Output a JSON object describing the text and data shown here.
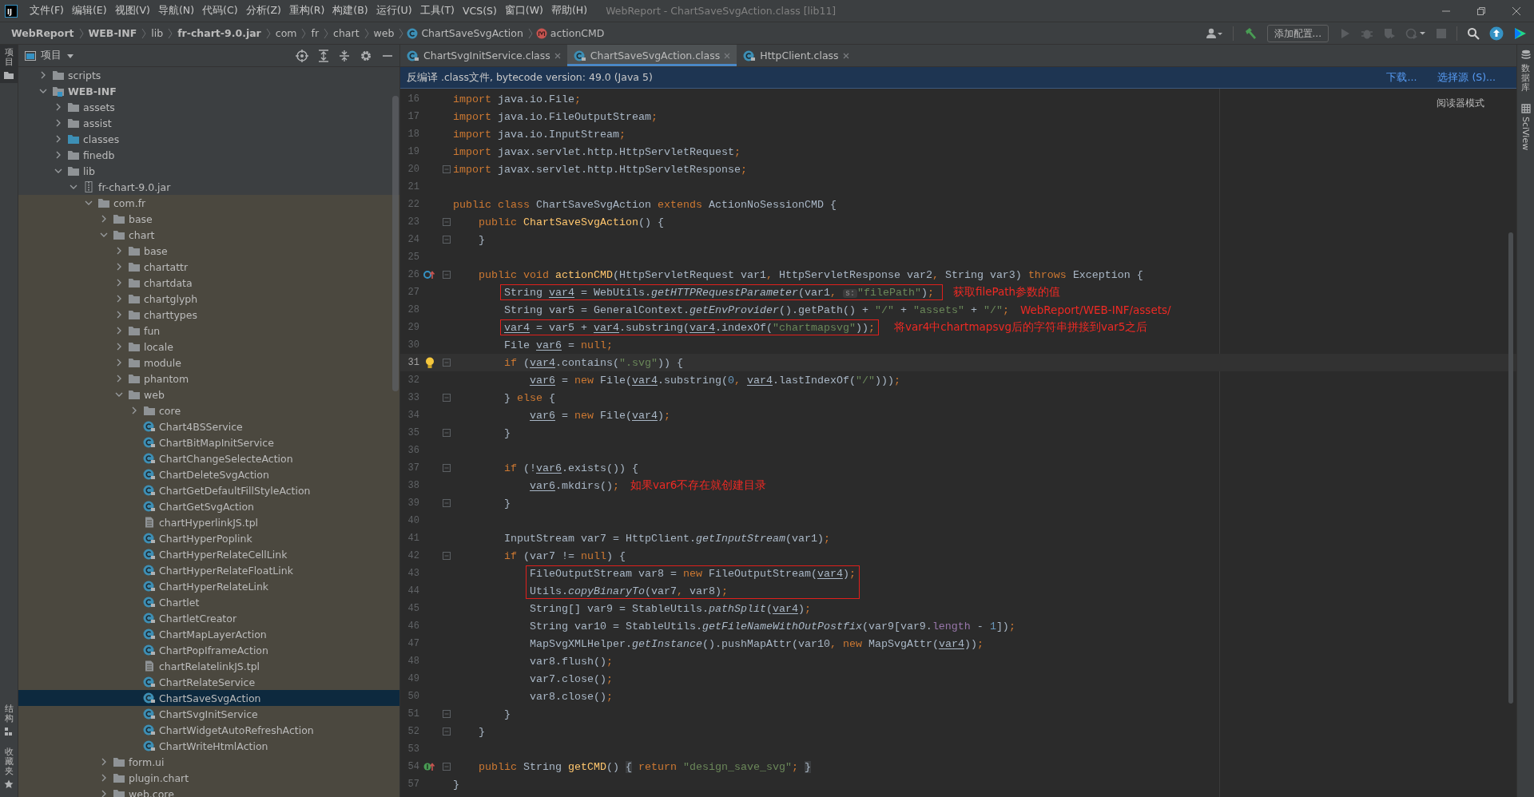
{
  "window": {
    "logo_text": "IJ",
    "title": "WebReport - ChartSaveSvgAction.class [lib11]"
  },
  "menu": [
    "文件(F)",
    "编辑(E)",
    "视图(V)",
    "导航(N)",
    "代码(C)",
    "分析(Z)",
    "重构(R)",
    "构建(B)",
    "运行(U)",
    "工具(T)",
    "VCS(S)",
    "窗口(W)",
    "帮助(H)"
  ],
  "breadcrumb": [
    {
      "label": "WebReport",
      "kind": "bold"
    },
    {
      "label": "WEB-INF",
      "kind": "bold"
    },
    {
      "label": "lib",
      "kind": "plain"
    },
    {
      "label": "fr-chart-9.0.jar",
      "kind": "bold"
    },
    {
      "label": "com",
      "kind": "plain"
    },
    {
      "label": "fr",
      "kind": "plain"
    },
    {
      "label": "chart",
      "kind": "plain"
    },
    {
      "label": "web",
      "kind": "plain"
    },
    {
      "label": "ChartSaveSvgAction",
      "kind": "class"
    },
    {
      "label": "actionCMD",
      "kind": "method"
    }
  ],
  "toolbar": {
    "config_button": "添加配置..."
  },
  "left_strip": {
    "top": [
      "项目"
    ],
    "bottom": [
      "结构",
      "收藏夹"
    ]
  },
  "right_strip": [
    "数据库",
    "SciView"
  ],
  "project_panel": {
    "title": "项目"
  },
  "tree": {
    "items": [
      {
        "label": "scripts",
        "kind": "folder",
        "selected": false,
        "expanded": false
      },
      {
        "label": "WEB-INF",
        "kind": "web_folder",
        "selected": false,
        "expanded": true,
        "children": [
          {
            "label": "assets",
            "kind": "folder",
            "selected": false,
            "expanded": false
          },
          {
            "label": "assist",
            "kind": "folder",
            "selected": false,
            "expanded": false
          },
          {
            "label": "classes",
            "kind": "source_folder",
            "selected": false,
            "expanded": false
          },
          {
            "label": "finedb",
            "kind": "folder",
            "selected": false,
            "expanded": false
          },
          {
            "label": "lib",
            "kind": "folder",
            "selected": false,
            "expanded": true,
            "children": [
              {
                "label": "fr-chart-9.0.jar",
                "kind": "jar",
                "selected": false,
                "expanded": true,
                "children": [
                  {
                    "label": "com.fr",
                    "kind": "package",
                    "selected": false,
                    "expanded": true,
                    "children": [
                      {
                        "label": "base",
                        "kind": "package",
                        "selected": false,
                        "expanded": false
                      },
                      {
                        "label": "chart",
                        "kind": "package",
                        "selected": false,
                        "expanded": true,
                        "children": [
                          {
                            "label": "base",
                            "kind": "package",
                            "selected": false,
                            "expanded": false
                          },
                          {
                            "label": "chartattr",
                            "kind": "package",
                            "selected": false,
                            "expanded": false
                          },
                          {
                            "label": "chartdata",
                            "kind": "package",
                            "selected": false,
                            "expanded": false
                          },
                          {
                            "label": "chartglyph",
                            "kind": "package",
                            "selected": false,
                            "expanded": false
                          },
                          {
                            "label": "charttypes",
                            "kind": "package",
                            "selected": false,
                            "expanded": false
                          },
                          {
                            "label": "fun",
                            "kind": "package",
                            "selected": false,
                            "expanded": false
                          },
                          {
                            "label": "locale",
                            "kind": "package",
                            "selected": false,
                            "expanded": false
                          },
                          {
                            "label": "module",
                            "kind": "package",
                            "selected": false,
                            "expanded": false
                          },
                          {
                            "label": "phantom",
                            "kind": "package",
                            "selected": false,
                            "expanded": false
                          },
                          {
                            "label": "web",
                            "kind": "package",
                            "selected": false,
                            "expanded": true,
                            "children": [
                              {
                                "label": "core",
                                "kind": "package",
                                "selected": false,
                                "expanded": false
                              },
                              {
                                "label": "Chart4BSService",
                                "kind": "class",
                                "selected": false
                              },
                              {
                                "label": "ChartBitMapInitService",
                                "kind": "class",
                                "selected": false
                              },
                              {
                                "label": "ChartChangeSelecteAction",
                                "kind": "class",
                                "selected": false
                              },
                              {
                                "label": "ChartDeleteSvgAction",
                                "kind": "class",
                                "selected": false
                              },
                              {
                                "label": "ChartGetDefaultFillStyleAction",
                                "kind": "class",
                                "selected": false
                              },
                              {
                                "label": "ChartGetSvgAction",
                                "kind": "class",
                                "selected": false
                              },
                              {
                                "label": "chartHyperlinkJS.tpl",
                                "kind": "file",
                                "selected": false
                              },
                              {
                                "label": "ChartHyperPoplink",
                                "kind": "class",
                                "selected": false
                              },
                              {
                                "label": "ChartHyperRelateCellLink",
                                "kind": "class",
                                "selected": false
                              },
                              {
                                "label": "ChartHyperRelateFloatLink",
                                "kind": "class",
                                "selected": false
                              },
                              {
                                "label": "ChartHyperRelateLink",
                                "kind": "class",
                                "selected": false
                              },
                              {
                                "label": "Chartlet",
                                "kind": "class",
                                "selected": false
                              },
                              {
                                "label": "ChartletCreator",
                                "kind": "class",
                                "selected": false
                              },
                              {
                                "label": "ChartMapLayerAction",
                                "kind": "class",
                                "selected": false
                              },
                              {
                                "label": "ChartPopIframeAction",
                                "kind": "class",
                                "selected": false
                              },
                              {
                                "label": "chartRelatelinkJS.tpl",
                                "kind": "file",
                                "selected": false
                              },
                              {
                                "label": "ChartRelateService",
                                "kind": "class",
                                "selected": false
                              },
                              {
                                "label": "ChartSaveSvgAction",
                                "kind": "class",
                                "selected": true
                              },
                              {
                                "label": "ChartSvgInitService",
                                "kind": "class",
                                "selected": false
                              },
                              {
                                "label": "ChartWidgetAutoRefreshAction",
                                "kind": "class",
                                "selected": false
                              },
                              {
                                "label": "ChartWriteHtmlAction",
                                "kind": "class",
                                "selected": false
                              }
                            ]
                          }
                        ]
                      },
                      {
                        "label": "form.ui",
                        "kind": "package",
                        "selected": false,
                        "expanded": false
                      },
                      {
                        "label": "plugin.chart",
                        "kind": "package",
                        "selected": false,
                        "expanded": false
                      },
                      {
                        "label": "web.core",
                        "kind": "package",
                        "selected": false,
                        "expanded": false
                      }
                    ]
                  }
                ]
              }
            ]
          }
        ]
      }
    ]
  },
  "editor": {
    "tabs": [
      {
        "label": "ChartSvgInitService.class",
        "selected": false
      },
      {
        "label": "ChartSaveSvgAction.class",
        "selected": true
      },
      {
        "label": "HttpClient.class",
        "selected": false
      }
    ],
    "banner": {
      "text": "反编译 .class文件, bytecode version: 49.0 (Java 5)",
      "links": [
        "下载...",
        "选择源 (S)..."
      ]
    },
    "reader_mode": "阅读器模式",
    "lines": [
      {
        "num": "16",
        "current": false,
        "boxed": false,
        "fold": false,
        "tokens": [
          {
            "text": "import ",
            "kind": "kw"
          },
          {
            "text": "java.io.File",
            "kind": "p"
          },
          {
            "text": ";",
            "kind": "kw"
          }
        ]
      },
      {
        "num": "17",
        "current": false,
        "boxed": false,
        "fold": false,
        "tokens": [
          {
            "text": "import ",
            "kind": "kw"
          },
          {
            "text": "java.io.FileOutputStream",
            "kind": "p"
          },
          {
            "text": ";",
            "kind": "kw"
          }
        ]
      },
      {
        "num": "18",
        "current": false,
        "boxed": false,
        "fold": false,
        "tokens": [
          {
            "text": "import ",
            "kind": "kw"
          },
          {
            "text": "java.io.InputStream",
            "kind": "p"
          },
          {
            "text": ";",
            "kind": "kw"
          }
        ]
      },
      {
        "num": "19",
        "current": false,
        "boxed": false,
        "fold": false,
        "tokens": [
          {
            "text": "import ",
            "kind": "kw"
          },
          {
            "text": "javax.servlet.http.HttpServletRequest",
            "kind": "p"
          },
          {
            "text": ";",
            "kind": "kw"
          }
        ]
      },
      {
        "num": "20",
        "current": false,
        "boxed": false,
        "fold": true,
        "tokens": [
          {
            "text": "import ",
            "kind": "kw"
          },
          {
            "text": "javax.servlet.http.HttpServletResponse",
            "kind": "p"
          },
          {
            "text": ";",
            "kind": "kw"
          }
        ]
      },
      {
        "num": "21",
        "current": false,
        "boxed": false,
        "fold": false
      },
      {
        "num": "22",
        "current": false,
        "boxed": false,
        "fold": false,
        "tokens": [
          {
            "text": "public class ",
            "kind": "kw"
          },
          {
            "text": "ChartSaveSvgAction ",
            "kind": "p"
          },
          {
            "text": "extends ",
            "kind": "kw"
          },
          {
            "text": "ActionNoSessionCMD {",
            "kind": "p"
          }
        ],
        "children": [
          {
            "num": "23",
            "current": false,
            "boxed": false,
            "fold": true,
            "tokens": [
              {
                "text": "public ",
                "kind": "kw"
              },
              {
                "text": "ChartSaveSvgAction",
                "kind": "fn"
              },
              {
                "text": "() {",
                "kind": "p"
              }
            ]
          },
          {
            "num": "24",
            "current": false,
            "boxed": false,
            "fold": true,
            "tokens": [
              {
                "text": "}",
                "kind": "p"
              }
            ]
          },
          {
            "num": "25",
            "current": false,
            "boxed": false,
            "fold": false
          },
          {
            "num": "26",
            "current": false,
            "boxed": false,
            "fold": true,
            "kind": "override",
            "tokens": [
              {
                "text": "public void ",
                "kind": "kw"
              },
              {
                "text": "actionCMD",
                "kind": "fn"
              },
              {
                "text": "(HttpServletRequest var1",
                "kind": "p"
              },
              {
                "text": ", ",
                "kind": "kw"
              },
              {
                "text": "HttpServletResponse var2",
                "kind": "p"
              },
              {
                "text": ", ",
                "kind": "kw"
              },
              {
                "text": "String var3) ",
                "kind": "p"
              },
              {
                "text": "throws ",
                "kind": "kw"
              },
              {
                "text": "Exception {",
                "kind": "p"
              }
            ],
            "children": [
              {
                "num": "27",
                "current": false,
                "boxed": true,
                "fold": false,
                "note": "获取filePath参数的值",
                "tokens": [
                  {
                    "text": "String ",
                    "kind": "p"
                  },
                  {
                    "text": "var4",
                    "kind": "v"
                  },
                  {
                    "text": " = WebUtils.",
                    "kind": "p"
                  },
                  {
                    "text": "getHTTPRequestParameter",
                    "kind": "it"
                  },
                  {
                    "text": "(var1",
                    "kind": "p"
                  },
                  {
                    "text": ", ",
                    "kind": "kw"
                  },
                  {
                    "text": "s:",
                    "kind": "hint"
                  },
                  {
                    "text": "\"filePath\"",
                    "kind": "str"
                  },
                  {
                    "text": ")",
                    "kind": "p"
                  },
                  {
                    "text": ";",
                    "kind": "kw"
                  }
                ]
              },
              {
                "num": "28",
                "current": false,
                "boxed": false,
                "fold": false,
                "note": "WebReport/WEB-INF/assets/",
                "tokens": [
                  {
                    "text": "String var5 = GeneralContext.",
                    "kind": "p"
                  },
                  {
                    "text": "getEnvProvider",
                    "kind": "it"
                  },
                  {
                    "text": "().getPath() + ",
                    "kind": "p"
                  },
                  {
                    "text": "\"/\"",
                    "kind": "str"
                  },
                  {
                    "text": " + ",
                    "kind": "p"
                  },
                  {
                    "text": "\"assets\"",
                    "kind": "str"
                  },
                  {
                    "text": " + ",
                    "kind": "p"
                  },
                  {
                    "text": "\"/\"",
                    "kind": "str"
                  },
                  {
                    "text": ";",
                    "kind": "kw"
                  }
                ]
              },
              {
                "num": "29",
                "current": false,
                "boxed": true,
                "fold": false,
                "note": "将var4中chartmapsvg后的字符串拼接到var5之后",
                "tokens": [
                  {
                    "text": "var4",
                    "kind": "v"
                  },
                  {
                    "text": " = var5 + ",
                    "kind": "p"
                  },
                  {
                    "text": "var4",
                    "kind": "v"
                  },
                  {
                    "text": ".substring(",
                    "kind": "p"
                  },
                  {
                    "text": "var4",
                    "kind": "v"
                  },
                  {
                    "text": ".indexOf(",
                    "kind": "p"
                  },
                  {
                    "text": "\"chartmapsvg\"",
                    "kind": "str"
                  },
                  {
                    "text": "))",
                    "kind": "p"
                  },
                  {
                    "text": ";",
                    "kind": "kw"
                  }
                ]
              },
              {
                "num": "30",
                "current": false,
                "boxed": false,
                "fold": false,
                "tokens": [
                  {
                    "text": "File ",
                    "kind": "p"
                  },
                  {
                    "text": "var6",
                    "kind": "v"
                  },
                  {
                    "text": " = ",
                    "kind": "p"
                  },
                  {
                    "text": "null",
                    "kind": "kw"
                  },
                  {
                    "text": ";",
                    "kind": "kw"
                  }
                ]
              },
              {
                "num": "31",
                "current": true,
                "boxed": false,
                "fold": true,
                "kind": "bulb",
                "tokens": [
                  {
                    "text": "if ",
                    "kind": "kw"
                  },
                  {
                    "text": "(",
                    "kind": "p"
                  },
                  {
                    "text": "var4",
                    "kind": "v"
                  },
                  {
                    "text": ".contains(",
                    "kind": "p"
                  },
                  {
                    "text": "\".svg\"",
                    "kind": "str"
                  },
                  {
                    "text": ")) {",
                    "kind": "p"
                  }
                ],
                "children": [
                  {
                    "num": "32",
                    "current": false,
                    "boxed": false,
                    "fold": false,
                    "tokens": [
                      {
                        "text": "var6",
                        "kind": "v"
                      },
                      {
                        "text": " = ",
                        "kind": "p"
                      },
                      {
                        "text": "new ",
                        "kind": "kw"
                      },
                      {
                        "text": "File(",
                        "kind": "p"
                      },
                      {
                        "text": "var4",
                        "kind": "v"
                      },
                      {
                        "text": ".substring(",
                        "kind": "p"
                      },
                      {
                        "text": "0",
                        "kind": "num"
                      },
                      {
                        "text": ", ",
                        "kind": "kw"
                      },
                      {
                        "text": "var4",
                        "kind": "v"
                      },
                      {
                        "text": ".lastIndexOf(",
                        "kind": "p"
                      },
                      {
                        "text": "\"/\"",
                        "kind": "str"
                      },
                      {
                        "text": ")))",
                        "kind": "p"
                      },
                      {
                        "text": ";",
                        "kind": "kw"
                      }
                    ]
                  }
                ]
              },
              {
                "num": "33",
                "current": false,
                "boxed": false,
                "fold": true,
                "tokens": [
                  {
                    "text": "} ",
                    "kind": "p"
                  },
                  {
                    "text": "else ",
                    "kind": "kw"
                  },
                  {
                    "text": "{",
                    "kind": "p"
                  }
                ],
                "children": [
                  {
                    "num": "34",
                    "current": false,
                    "boxed": false,
                    "fold": false,
                    "tokens": [
                      {
                        "text": "var6",
                        "kind": "v"
                      },
                      {
                        "text": " = ",
                        "kind": "p"
                      },
                      {
                        "text": "new ",
                        "kind": "kw"
                      },
                      {
                        "text": "File(",
                        "kind": "p"
                      },
                      {
                        "text": "var4",
                        "kind": "v"
                      },
                      {
                        "text": ")",
                        "kind": "p"
                      },
                      {
                        "text": ";",
                        "kind": "kw"
                      }
                    ]
                  }
                ]
              },
              {
                "num": "35",
                "current": false,
                "boxed": false,
                "fold": true,
                "tokens": [
                  {
                    "text": "}",
                    "kind": "p"
                  }
                ]
              },
              {
                "num": "36",
                "current": false,
                "boxed": false,
                "fold": false
              },
              {
                "num": "37",
                "current": false,
                "boxed": false,
                "fold": true,
                "tokens": [
                  {
                    "text": "if ",
                    "kind": "kw"
                  },
                  {
                    "text": "(!",
                    "kind": "p"
                  },
                  {
                    "text": "var6",
                    "kind": "v"
                  },
                  {
                    "text": ".exists()) {",
                    "kind": "p"
                  }
                ],
                "children": [
                  {
                    "num": "38",
                    "current": false,
                    "boxed": false,
                    "fold": false,
                    "note": "如果var6不存在就创建目录",
                    "tokens": [
                      {
                        "text": "var6",
                        "kind": "v"
                      },
                      {
                        "text": ".mkdirs()",
                        "kind": "p"
                      },
                      {
                        "text": ";",
                        "kind": "kw"
                      }
                    ]
                  }
                ]
              },
              {
                "num": "39",
                "current": false,
                "boxed": false,
                "fold": true,
                "tokens": [
                  {
                    "text": "}",
                    "kind": "p"
                  }
                ]
              },
              {
                "num": "40",
                "current": false,
                "boxed": false,
                "fold": false
              },
              {
                "num": "41",
                "current": false,
                "boxed": false,
                "fold": false,
                "tokens": [
                  {
                    "text": "InputStream var7 = HttpClient.",
                    "kind": "p"
                  },
                  {
                    "text": "getInputStream",
                    "kind": "it"
                  },
                  {
                    "text": "(var1)",
                    "kind": "p"
                  },
                  {
                    "text": ";",
                    "kind": "kw"
                  }
                ]
              },
              {
                "num": "42",
                "current": false,
                "boxed": false,
                "fold": true,
                "tokens": [
                  {
                    "text": "if ",
                    "kind": "kw"
                  },
                  {
                    "text": "(var7 != ",
                    "kind": "p"
                  },
                  {
                    "text": "null",
                    "kind": "kw"
                  },
                  {
                    "text": ") {",
                    "kind": "p"
                  }
                ],
                "children": [
                  {
                    "num": "43",
                    "current": false,
                    "boxed": true,
                    "fold": false,
                    "tokens": [
                      {
                        "text": "FileOutputStream var8 = ",
                        "kind": "p"
                      },
                      {
                        "text": "new ",
                        "kind": "kw"
                      },
                      {
                        "text": "FileOutputStream(",
                        "kind": "p"
                      },
                      {
                        "text": "var4",
                        "kind": "v"
                      },
                      {
                        "text": ")",
                        "kind": "p"
                      },
                      {
                        "text": ";",
                        "kind": "kw"
                      }
                    ]
                  },
                  {
                    "num": "44",
                    "current": false,
                    "boxed": true,
                    "fold": false,
                    "tokens": [
                      {
                        "text": "Utils.",
                        "kind": "p"
                      },
                      {
                        "text": "copyBinaryTo",
                        "kind": "it"
                      },
                      {
                        "text": "(var7",
                        "kind": "p"
                      },
                      {
                        "text": ", ",
                        "kind": "kw"
                      },
                      {
                        "text": "var8)",
                        "kind": "p"
                      },
                      {
                        "text": ";",
                        "kind": "kw"
                      }
                    ]
                  },
                  {
                    "num": "45",
                    "current": false,
                    "boxed": false,
                    "fold": false,
                    "tokens": [
                      {
                        "text": "String[] var9 = StableUtils.",
                        "kind": "p"
                      },
                      {
                        "text": "pathSplit",
                        "kind": "it"
                      },
                      {
                        "text": "(",
                        "kind": "p"
                      },
                      {
                        "text": "var4",
                        "kind": "v"
                      },
                      {
                        "text": ")",
                        "kind": "p"
                      },
                      {
                        "text": ";",
                        "kind": "kw"
                      }
                    ]
                  },
                  {
                    "num": "46",
                    "current": false,
                    "boxed": false,
                    "fold": false,
                    "tokens": [
                      {
                        "text": "String var10 = StableUtils.",
                        "kind": "p"
                      },
                      {
                        "text": "getFileNameWithOutPostfix",
                        "kind": "it"
                      },
                      {
                        "text": "(var9[var9.",
                        "kind": "p"
                      },
                      {
                        "text": "length",
                        "kind": "fld"
                      },
                      {
                        "text": " - ",
                        "kind": "p"
                      },
                      {
                        "text": "1",
                        "kind": "num"
                      },
                      {
                        "text": "])",
                        "kind": "p"
                      },
                      {
                        "text": ";",
                        "kind": "kw"
                      }
                    ]
                  },
                  {
                    "num": "47",
                    "current": false,
                    "boxed": false,
                    "fold": false,
                    "tokens": [
                      {
                        "text": "MapSvgXMLHelper.",
                        "kind": "p"
                      },
                      {
                        "text": "getInstance",
                        "kind": "it"
                      },
                      {
                        "text": "().pushMapAttr(var10",
                        "kind": "p"
                      },
                      {
                        "text": ", ",
                        "kind": "kw"
                      },
                      {
                        "text": "new ",
                        "kind": "kw"
                      },
                      {
                        "text": "MapSvgAttr(",
                        "kind": "p"
                      },
                      {
                        "text": "var4",
                        "kind": "v"
                      },
                      {
                        "text": "))",
                        "kind": "p"
                      },
                      {
                        "text": ";",
                        "kind": "kw"
                      }
                    ]
                  },
                  {
                    "num": "48",
                    "current": false,
                    "boxed": false,
                    "fold": false,
                    "tokens": [
                      {
                        "text": "var8.flush()",
                        "kind": "p"
                      },
                      {
                        "text": ";",
                        "kind": "kw"
                      }
                    ]
                  },
                  {
                    "num": "49",
                    "current": false,
                    "boxed": false,
                    "fold": false,
                    "tokens": [
                      {
                        "text": "var7.close()",
                        "kind": "p"
                      },
                      {
                        "text": ";",
                        "kind": "kw"
                      }
                    ]
                  },
                  {
                    "num": "50",
                    "current": false,
                    "boxed": false,
                    "fold": false,
                    "tokens": [
                      {
                        "text": "var8.close()",
                        "kind": "p"
                      },
                      {
                        "text": ";",
                        "kind": "kw"
                      }
                    ]
                  }
                ]
              },
              {
                "num": "51",
                "current": false,
                "boxed": false,
                "fold": true,
                "tokens": [
                  {
                    "text": "}",
                    "kind": "p"
                  }
                ]
              }
            ]
          },
          {
            "num": "52",
            "current": false,
            "boxed": false,
            "fold": true,
            "tokens": [
              {
                "text": "}",
                "kind": "p"
              }
            ]
          },
          {
            "num": "53",
            "current": false,
            "boxed": false,
            "fold": false
          },
          {
            "num": "54",
            "current": false,
            "boxed": false,
            "fold": true,
            "kind": "implements",
            "tokens": [
              {
                "text": "public ",
                "kind": "kw"
              },
              {
                "text": "String ",
                "kind": "p"
              },
              {
                "text": "getCMD",
                "kind": "fn"
              },
              {
                "text": "() ",
                "kind": "p"
              },
              {
                "text": "{",
                "kind": "br"
              },
              {
                "text": " return ",
                "kind": "kw"
              },
              {
                "text": "\"design_save_svg\"",
                "kind": "str"
              },
              {
                "text": "; ",
                "kind": "kw"
              },
              {
                "text": "}",
                "kind": "br"
              }
            ]
          }
        ]
      },
      {
        "num": "57",
        "current": false,
        "boxed": false,
        "fold": false,
        "tokens": [
          {
            "text": "}",
            "kind": "p"
          }
        ]
      }
    ]
  }
}
